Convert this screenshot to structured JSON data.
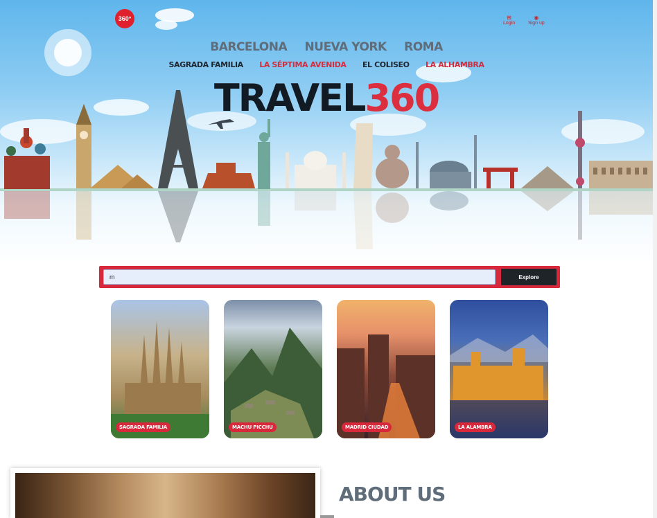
{
  "header": {
    "logo_text": "360°",
    "login_label": "Login",
    "signup_label": "Sign up"
  },
  "cities": [
    "BARCELONA",
    "NUEVA YORK",
    "ROMA"
  ],
  "landmarks": [
    "SAGRADA FAMILIA",
    "LA SÉPTIMA AVENIDA",
    "EL COLISEO",
    "LA ALHAMBRA"
  ],
  "brand": {
    "part1": "TRAVEL",
    "part2": "360"
  },
  "search": {
    "value": "m",
    "button_label": "Explore"
  },
  "cards": [
    {
      "label": "SAGRADA FAMILIA"
    },
    {
      "label": "MACHU PICCHU"
    },
    {
      "label": "MADRID CIUDAD"
    },
    {
      "label": "LA ALAMBRA"
    }
  ],
  "about": {
    "title": "ABOUT US"
  },
  "colors": {
    "accent": "#d8293c",
    "dark": "#1f2429",
    "muted": "#5f6d7a"
  }
}
